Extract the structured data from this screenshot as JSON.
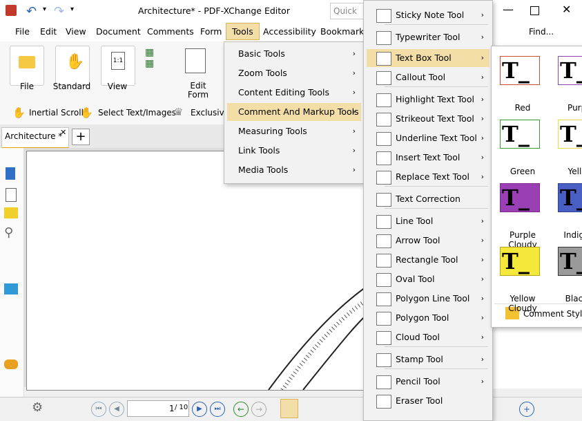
{
  "window": {
    "title": "Architecture* - PDF-XChange Editor",
    "search_placeholder": "Quick La"
  },
  "menubar": [
    "File",
    "Edit",
    "View",
    "Document",
    "Comments",
    "Form",
    "Tools",
    "Accessibility",
    "Bookmarks"
  ],
  "ribbon": {
    "file": "File",
    "standard": "Standard",
    "view": "View",
    "edit_form": "Edit\nForm"
  },
  "quick": {
    "inertial": "Inertial Scroll",
    "select": "Select Text/Images",
    "exclusive": "Exclusive"
  },
  "find_label": "Find...",
  "tab": {
    "label": "Architecture *"
  },
  "status": {
    "page_input": "1",
    "page_total": "/ 10"
  },
  "tools_menu": [
    "Basic Tools",
    "Zoom Tools",
    "Content Editing Tools",
    "Comment And Markup Tools",
    "Measuring Tools",
    "Link Tools",
    "Media Tools"
  ],
  "markup_menu": [
    {
      "label": "Sticky Note Tool",
      "icon": "sticky-note-icon",
      "arrow": true
    },
    {
      "label": "Typewriter Tool",
      "icon": "typewriter-icon",
      "arrow": true
    },
    {
      "label": "Text Box Tool",
      "icon": "text-box-icon",
      "arrow": true
    },
    {
      "label": "Callout Tool",
      "icon": "callout-icon",
      "arrow": true
    },
    {
      "label": "Highlight Text Tool",
      "icon": "highlight-icon",
      "arrow": true
    },
    {
      "label": "Strikeout Text Tool",
      "icon": "strikeout-icon",
      "arrow": true
    },
    {
      "label": "Underline Text Tool",
      "icon": "underline-icon",
      "arrow": true
    },
    {
      "label": "Insert Text Tool",
      "icon": "insert-text-icon",
      "arrow": true
    },
    {
      "label": "Replace Text Tool",
      "icon": "replace-text-icon",
      "arrow": true
    },
    {
      "label": "Text Correction",
      "icon": "text-correction-icon",
      "arrow": false
    },
    {
      "label": "Line Tool",
      "icon": "line-icon",
      "arrow": true
    },
    {
      "label": "Arrow Tool",
      "icon": "arrow-icon",
      "arrow": true
    },
    {
      "label": "Rectangle Tool",
      "icon": "rectangle-icon",
      "arrow": true
    },
    {
      "label": "Oval Tool",
      "icon": "oval-icon",
      "arrow": true
    },
    {
      "label": "Polygon Line Tool",
      "icon": "polygon-line-icon",
      "arrow": true
    },
    {
      "label": "Polygon Tool",
      "icon": "polygon-icon",
      "arrow": true
    },
    {
      "label": "Cloud Tool",
      "icon": "cloud-icon",
      "arrow": true
    },
    {
      "label": "Stamp Tool",
      "icon": "stamp-icon",
      "arrow": true
    },
    {
      "label": "Pencil Tool",
      "icon": "pencil-icon",
      "arrow": true
    },
    {
      "label": "Eraser Tool",
      "icon": "eraser-icon",
      "arrow": false
    }
  ],
  "styles": [
    {
      "label": "Red",
      "border": "#d04b3a",
      "fill": "#ffffff"
    },
    {
      "label": "Purple",
      "border": "#8e44ad",
      "fill": "#ffffff"
    },
    {
      "label": "Green",
      "border": "#3c9a3c",
      "fill": "#ffffff"
    },
    {
      "label": "Yellow",
      "border": "#e8d84a",
      "fill": "#ffffff"
    },
    {
      "label": "Purple Cloudy",
      "border": "#7b2a8a",
      "fill": "#9b3fb5"
    },
    {
      "label": "Indigo C",
      "border": "#2d3f8f",
      "fill": "#4a5fc4"
    },
    {
      "label": "Yellow Cloudy",
      "border": "#b8a41a",
      "fill": "#f4e83a"
    },
    {
      "label": "Black C",
      "border": "#333333",
      "fill": "#9a9a9a"
    }
  ],
  "comment_styles": "Comment Styles"
}
